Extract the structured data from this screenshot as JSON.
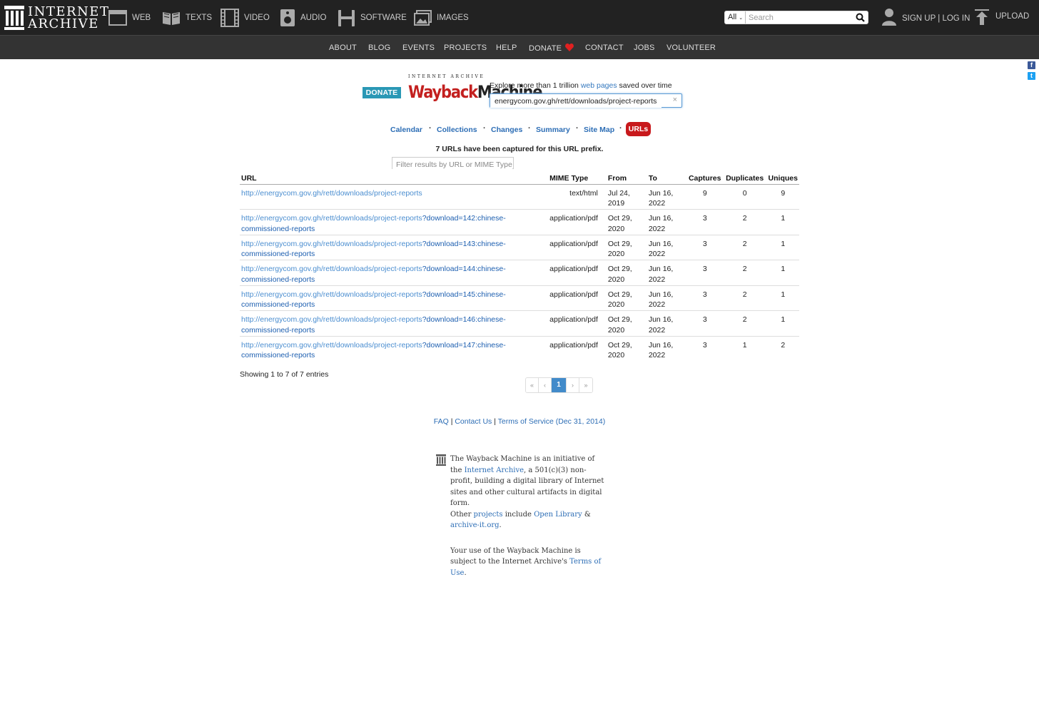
{
  "topbar": {
    "logo_line1": "INTERNET",
    "logo_line2": "ARCHIVE",
    "media": [
      {
        "label": "WEB",
        "icon": "web-icon"
      },
      {
        "label": "TEXTS",
        "icon": "book-icon"
      },
      {
        "label": "VIDEO",
        "icon": "film-icon"
      },
      {
        "label": "AUDIO",
        "icon": "speaker-icon"
      },
      {
        "label": "SOFTWARE",
        "icon": "floppy-icon"
      },
      {
        "label": "IMAGES",
        "icon": "image-icon"
      }
    ],
    "search_scope": "All",
    "search_placeholder": "Search",
    "signup_login": "SIGN UP | LOG IN",
    "upload": "UPLOAD"
  },
  "subnav": [
    "ABOUT",
    "BLOG",
    "EVENTS",
    "PROJECTS",
    "HELP",
    "DONATE",
    "CONTACT",
    "JOBS",
    "VOLUNTEER"
  ],
  "wayback": {
    "donate": "DONATE",
    "logo_small": "INTERNET ARCHIVE",
    "logo_wayback": "Wayback",
    "logo_machine": "Machine",
    "explore_pre": "Explore more than 1 trillion ",
    "explore_link": "web pages",
    "explore_post": " saved over time",
    "url_value": "energycom.gov.gh/rett/downloads/project-reports",
    "clear": "×"
  },
  "tabs": [
    "Calendar",
    "Collections",
    "Changes",
    "Summary",
    "Site Map"
  ],
  "active_tab": "URLs",
  "tab_separator": "·",
  "count_message": "7 URLs have been captured for this URL prefix.",
  "filter_placeholder": "Filter results by URL or MIME Type",
  "table": {
    "headers": [
      "URL",
      "MIME Type",
      "From",
      "To",
      "Captures",
      "Duplicates",
      "Uniques"
    ],
    "rows": [
      {
        "base": "http://energycom.gov.gh/rett/downloads/project-reports",
        "rest": "",
        "rest2": "",
        "mime": "text/html",
        "from1": "Jul 24,",
        "from2": "2019",
        "to1": "Jun 16,",
        "to2": "2022",
        "captures": "9",
        "duplicates": "0",
        "uniques": "9"
      },
      {
        "base": "http://energycom.gov.gh/rett/downloads/project-reports",
        "rest": "?download=142:chinese-",
        "rest2": "commissioned-reports",
        "mime": "application/pdf",
        "from1": "Oct 29,",
        "from2": "2020",
        "to1": "Jun 16,",
        "to2": "2022",
        "captures": "3",
        "duplicates": "2",
        "uniques": "1"
      },
      {
        "base": "http://energycom.gov.gh/rett/downloads/project-reports",
        "rest": "?download=143:chinese-",
        "rest2": "commissioned-reports",
        "mime": "application/pdf",
        "from1": "Oct 29,",
        "from2": "2020",
        "to1": "Jun 16,",
        "to2": "2022",
        "captures": "3",
        "duplicates": "2",
        "uniques": "1"
      },
      {
        "base": "http://energycom.gov.gh/rett/downloads/project-reports",
        "rest": "?download=144:chinese-",
        "rest2": "commissioned-reports",
        "mime": "application/pdf",
        "from1": "Oct 29,",
        "from2": "2020",
        "to1": "Jun 16,",
        "to2": "2022",
        "captures": "3",
        "duplicates": "2",
        "uniques": "1"
      },
      {
        "base": "http://energycom.gov.gh/rett/downloads/project-reports",
        "rest": "?download=145:chinese-",
        "rest2": "commissioned-reports",
        "mime": "application/pdf",
        "from1": "Oct 29,",
        "from2": "2020",
        "to1": "Jun 16,",
        "to2": "2022",
        "captures": "3",
        "duplicates": "2",
        "uniques": "1"
      },
      {
        "base": "http://energycom.gov.gh/rett/downloads/project-reports",
        "rest": "?download=146:chinese-",
        "rest2": "commissioned-reports",
        "mime": "application/pdf",
        "from1": "Oct 29,",
        "from2": "2020",
        "to1": "Jun 16,",
        "to2": "2022",
        "captures": "3",
        "duplicates": "2",
        "uniques": "1"
      },
      {
        "base": "http://energycom.gov.gh/rett/downloads/project-reports",
        "rest": "?download=147:chinese-",
        "rest2": "commissioned-reports",
        "mime": "application/pdf",
        "from1": "Oct 29,",
        "from2": "2020",
        "to1": "Jun 16,",
        "to2": "2022",
        "captures": "3",
        "duplicates": "1",
        "uniques": "2"
      }
    ]
  },
  "showing": "Showing 1 to 7 of 7 entries",
  "pager": {
    "first": "«",
    "prev": "‹",
    "current": "1",
    "next": "›",
    "last": "»"
  },
  "footer": {
    "faq": "FAQ",
    "contact": "Contact Us",
    "terms": "Terms of Service (Dec 31, 2014)",
    "sep": " | "
  },
  "about": {
    "p1_a": "The Wayback Machine is an initiative of the ",
    "p1_link": "Internet Archive",
    "p1_b": ", a 501(c)(3) non-profit, building a digital library of Internet sites and other cultural artifacts in digital form.",
    "p1_c": "Other ",
    "p1_projects": "projects",
    "p1_d": " include ",
    "p1_openlib": "Open Library",
    "p1_e": " & ",
    "p1_archiveit": "archive-it.org",
    "p1_f": ".",
    "p2_a": "Your use of the Wayback Machine is subject to the Internet Archive's ",
    "p2_link": "Terms of Use",
    "p2_b": "."
  },
  "social": {
    "facebook": "f",
    "twitter": "t"
  },
  "colors": {
    "topbar": "#222222",
    "subnav": "#333333",
    "donate": "#2a98b5",
    "active_tab": "#c8191c",
    "link": "#2c6db5",
    "heart": "#e02020"
  }
}
